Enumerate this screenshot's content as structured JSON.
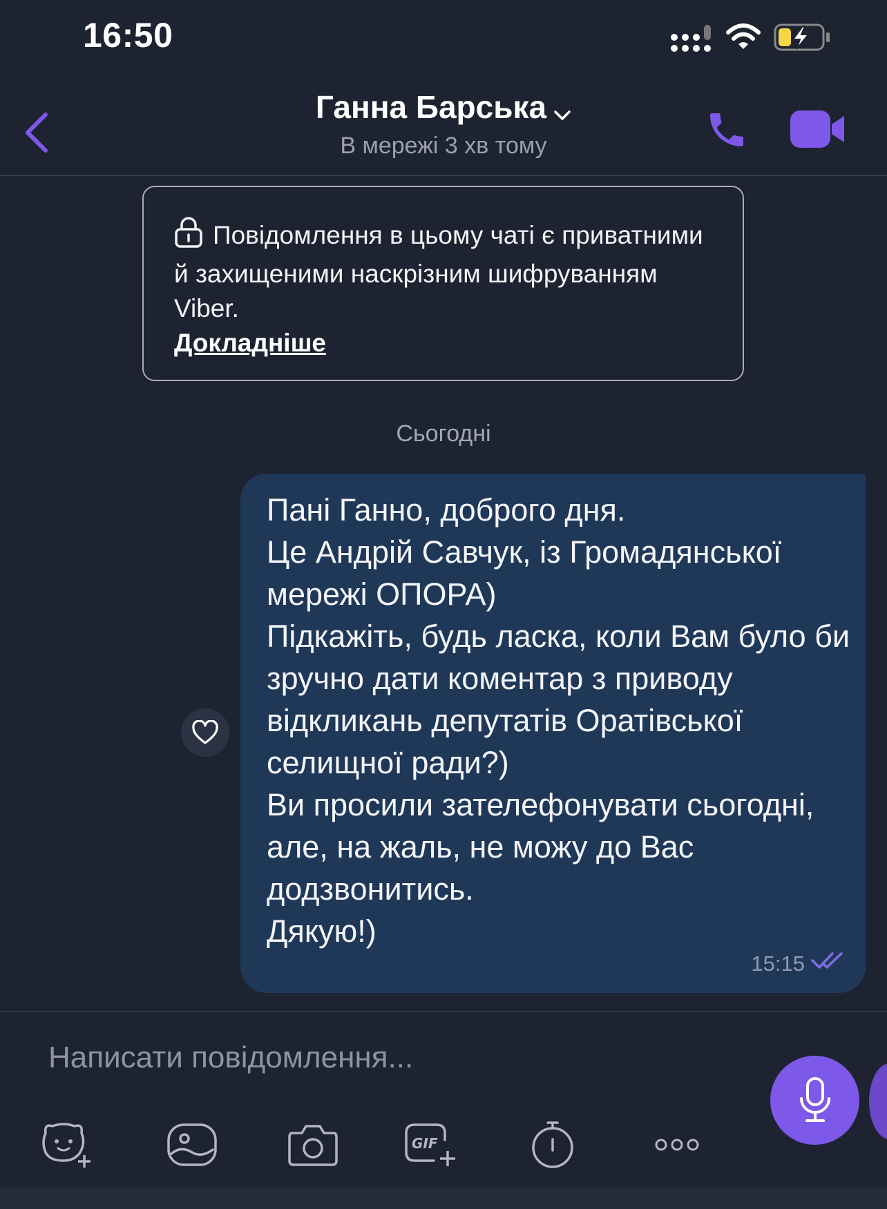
{
  "status_bar": {
    "time": "16:50"
  },
  "header": {
    "contact_name": "Ганна Барська",
    "presence": "В мережі 3 хв тому"
  },
  "notice": {
    "text": "Повідомлення в цьому чаті є приватними й захищеними наскрізним шифруванням Viber.",
    "link": "Докладніше"
  },
  "date_separator": "Сьогодні",
  "message": {
    "text": "Пані Ганно, доброго дня.\nЦе Андрій Савчук, із Громадянської мережі ОПОРА)\nПідкажіть, будь ласка, коли Вам було би зручно дати коментар з приводу відкликань депутатів Оратівської селищної ради?)\nВи просили зателефонувати сьогодні, але, на жаль, не можу до Вас додзвонитись.\nДякую!)",
    "time": "15:15",
    "status": "read"
  },
  "composer": {
    "placeholder": "Написати повідомлення..."
  },
  "icons": {
    "back": "chevron-left-icon",
    "call": "phone-icon",
    "video": "video-camera-icon",
    "lock": "lock-icon",
    "heart": "heart-icon",
    "mic": "microphone-icon",
    "tools": [
      "sticker-add-icon",
      "gallery-icon",
      "camera-icon",
      "gif-add-icon",
      "timer-icon",
      "more-icon"
    ]
  },
  "colors": {
    "accent": "#7e58e8",
    "bubble": "#203858",
    "background": "#1e2331"
  }
}
